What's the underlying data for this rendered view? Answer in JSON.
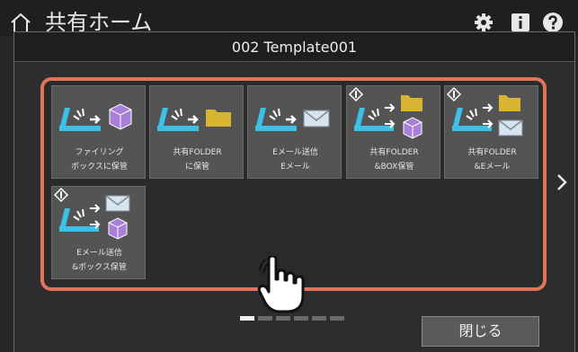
{
  "header": {
    "title": "共有ホーム",
    "icons": [
      "home-icon",
      "gear-icon",
      "info-icon",
      "help-icon"
    ]
  },
  "dialog": {
    "title": "002 Template001",
    "close_label": "閉じる"
  },
  "templates": [
    {
      "line1": "ファイリング",
      "line2": "ボックスに保管",
      "icon": "scan-to-box-icon"
    },
    {
      "line1": "共有FOLDER",
      "line2": "に保管",
      "icon": "scan-to-folder-icon"
    },
    {
      "line1": "Eメール送信",
      "line2": "Eメール",
      "icon": "scan-to-email-icon"
    },
    {
      "line1": "共有FOLDER",
      "line2": "&BOX保管",
      "icon": "scan-to-folder-box-icon"
    },
    {
      "line1": "共有FOLDER",
      "line2": "&Eメール",
      "icon": "scan-to-folder-email-icon"
    },
    {
      "line1": "Eメール送信",
      "line2": "&ボックス保管",
      "icon": "scan-to-email-box-icon"
    }
  ],
  "pager": {
    "current": 1,
    "total": 6
  },
  "colors": {
    "highlight": "#e0735a",
    "scanner": "#3cc0e6",
    "box": "#a97fd9",
    "folder": "#d8b531",
    "mail": "#d8e4ee"
  }
}
